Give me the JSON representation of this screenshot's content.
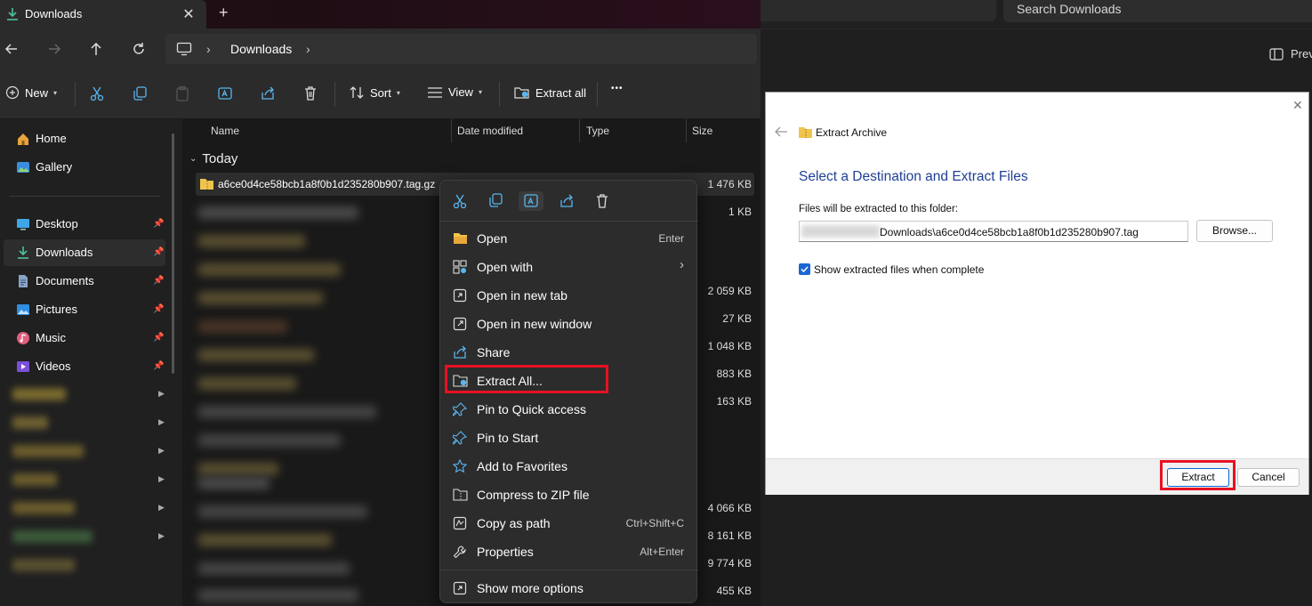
{
  "explorer": {
    "tab_title": "Downloads",
    "tab_close": "✕",
    "new_tab": "+",
    "breadcrumb": {
      "sep": "›",
      "location": "Downloads"
    },
    "toolbar": {
      "new_label": "New",
      "sort_label": "Sort",
      "view_label": "View",
      "extract_all_label": "Extract all",
      "more": "•••"
    },
    "sidebar": {
      "top_items": [
        {
          "label": "Home",
          "icon": "home-icon"
        },
        {
          "label": "Gallery",
          "icon": "gallery-icon"
        }
      ],
      "pinned_items": [
        {
          "label": "Desktop",
          "icon": "desktop-icon"
        },
        {
          "label": "Downloads",
          "icon": "download-icon",
          "selected": true
        },
        {
          "label": "Documents",
          "icon": "documents-icon"
        },
        {
          "label": "Pictures",
          "icon": "pictures-icon"
        },
        {
          "label": "Music",
          "icon": "music-icon"
        },
        {
          "label": "Videos",
          "icon": "videos-icon"
        }
      ]
    },
    "columns": {
      "name": "Name",
      "date_modified": "Date modified",
      "type": "Type",
      "size": "Size"
    },
    "group_label": "Today",
    "selected_file": {
      "name": "a6ce0d4ce58bcb1a8f0b1d235280b907.tag.gz",
      "size": "1 476 KB"
    },
    "sizes": [
      "1 KB",
      "",
      "",
      "2 059 KB",
      "27 KB",
      "1 048 KB",
      "883 KB",
      "163 KB",
      "",
      "",
      "",
      "4 066 KB",
      "8 161 KB",
      "9 774 KB",
      "455 KB"
    ]
  },
  "context_menu": {
    "items": [
      {
        "label": "Open",
        "shortcut": "Enter",
        "icon": "folder-open-icon"
      },
      {
        "label": "Open with",
        "shortcut": "",
        "icon": "open-with-icon",
        "submenu": "›"
      },
      {
        "label": "Open in new tab",
        "shortcut": "",
        "icon": "new-tab-icon"
      },
      {
        "label": "Open in new window",
        "shortcut": "",
        "icon": "new-window-icon"
      },
      {
        "label": "Share",
        "shortcut": "",
        "icon": "share-icon"
      },
      {
        "label": "Extract All...",
        "shortcut": "",
        "icon": "extract-icon",
        "highlighted": true
      },
      {
        "label": "Pin to Quick access",
        "shortcut": "",
        "icon": "pin-icon"
      },
      {
        "label": "Pin to Start",
        "shortcut": "",
        "icon": "pin-start-icon"
      },
      {
        "label": "Add to Favorites",
        "shortcut": "",
        "icon": "star-icon"
      },
      {
        "label": "Compress to ZIP file",
        "shortcut": "",
        "icon": "zip-icon"
      },
      {
        "label": "Copy as path",
        "shortcut": "Ctrl+Shift+C",
        "icon": "copy-path-icon"
      },
      {
        "label": "Properties",
        "shortcut": "Alt+Enter",
        "icon": "properties-icon"
      }
    ],
    "more_options": {
      "label": "Show more options",
      "icon": "more-options-icon"
    }
  },
  "right_window": {
    "search_placeholder": "Search Downloads",
    "preview_label": "Prev"
  },
  "dialog": {
    "close": "✕",
    "title": "Extract Archive",
    "heading": "Select a Destination and Extract Files",
    "label": "Files will be extracted to this folder:",
    "path_value": "Downloads\\a6ce0d4ce58bcb1a8f0b1d235280b907.tag",
    "browse_label": "Browse...",
    "checkbox_label": "Show extracted files when complete",
    "checkbox_checked": true,
    "extract_label": "Extract",
    "cancel_label": "Cancel"
  },
  "colors": {
    "highlight_box": "#e81123",
    "accent_blue": "#1967d2",
    "folder_yellow": "#f0c44c"
  }
}
